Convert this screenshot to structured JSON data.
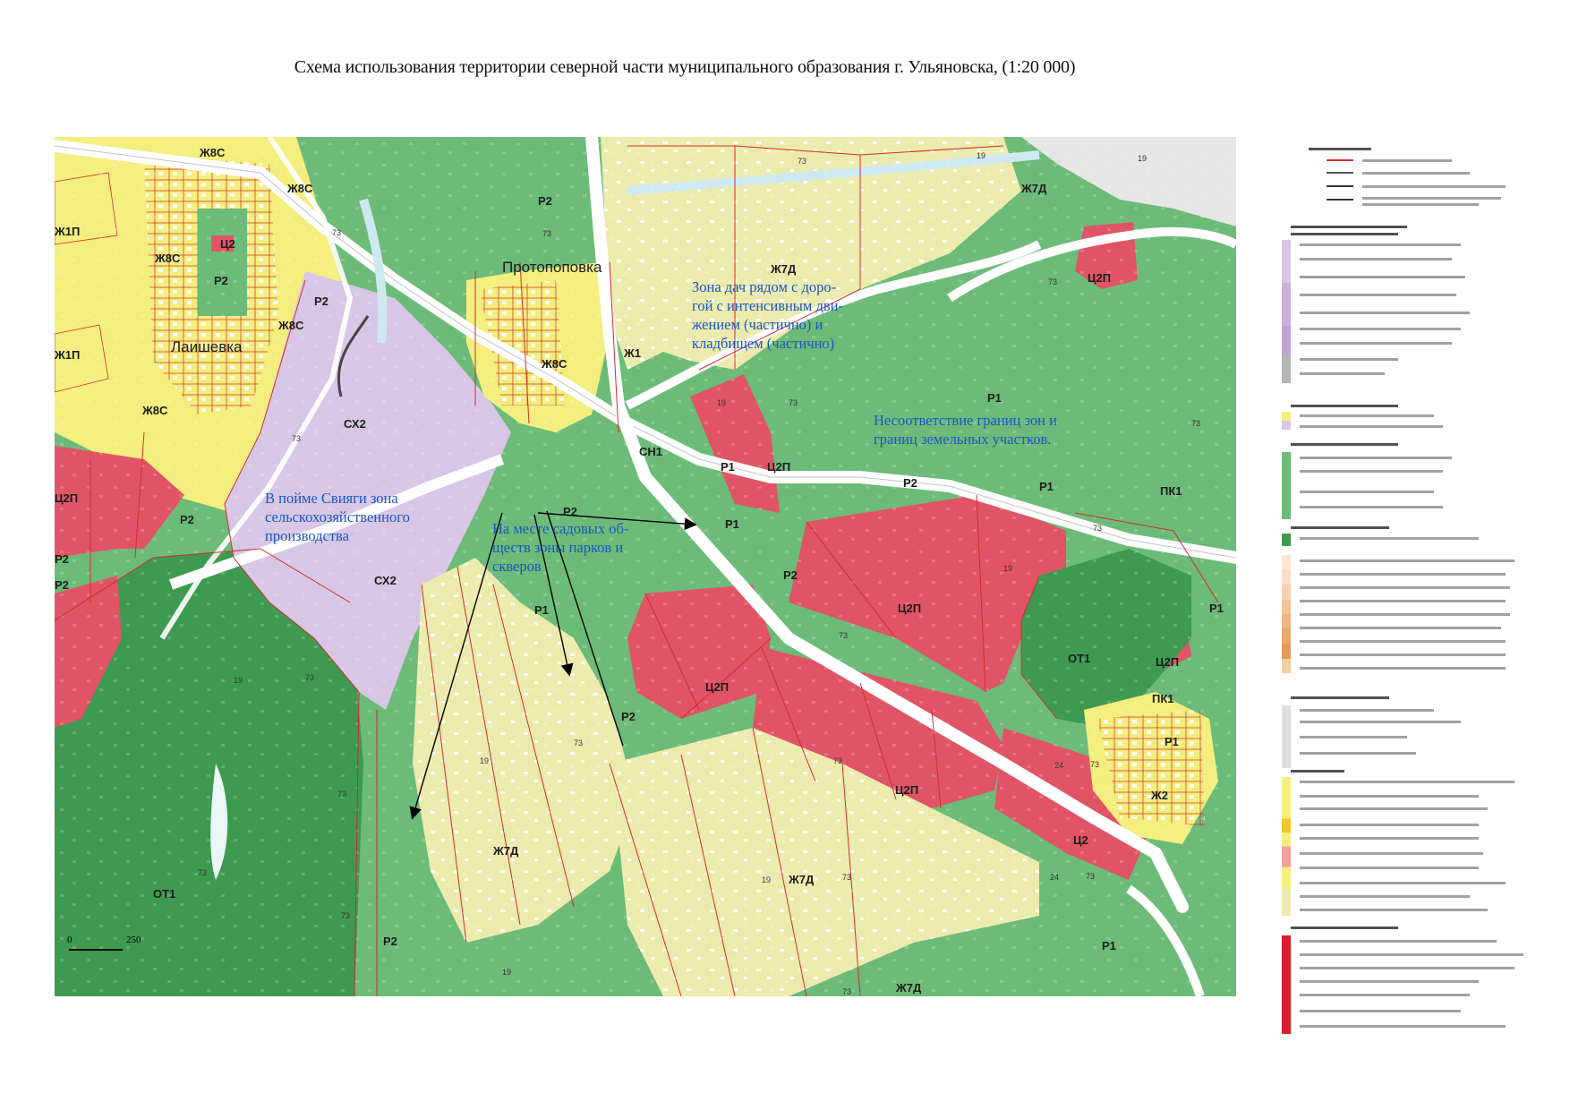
{
  "title": "Схема использования территории северной части муниципального образования г. Ульяновска, (1:20 000)",
  "places": {
    "protopopovka": "Протопоповка",
    "laishevka": "Лаишевка"
  },
  "zone_labels": {
    "zh8s_1": "Ж8С",
    "zh8s_2": "Ж8С",
    "zh8s_3": "Ж8С",
    "zh8s_4": "Ж8С",
    "zh8s_5": "Ж8С",
    "zh8s_6": "Ж8С",
    "zh1p_1": "Ж1П",
    "zh1p_2": "Ж1П",
    "c2_1": "Ц2",
    "c2_2": "Ц2",
    "p2_1": "Р2",
    "p2_2": "Р2",
    "p2_3": "Р2",
    "p2_4": "Р2",
    "p2_5": "Р2",
    "p2_6": "Р2",
    "p2_7": "Р2",
    "p2_8": "Р2",
    "p2_9": "Р2",
    "p2_10": "Р2",
    "p2_11": "Р2",
    "c2p_1": "Ц2П",
    "c2p_2": "Ц2П",
    "c2p_3": "Ц2П",
    "c2p_4": "Ц2П",
    "c2p_5": "Ц2П",
    "c2p_6": "Ц2П",
    "c2p_7": "Ц2П",
    "sx2_1": "СХ2",
    "sx2_2": "СХ2",
    "zh7d_1": "Ж7Д",
    "zh7d_2": "Ж7Д",
    "zh7d_3": "Ж7Д",
    "zh7d_4": "Ж7Д",
    "zh7d_5": "Ж7Д",
    "zh1": "Ж1",
    "zh2": "Ж2",
    "p1_1": "Р1",
    "p1_2": "Р1",
    "p1_3": "Р1",
    "p1_4": "Р1",
    "p1_5": "Р1",
    "p1_6": "Р1",
    "p1_7": "Р1",
    "p1_8": "Р1",
    "ot1_1": "ОТ1",
    "ot1_2": "ОТ1",
    "pk1_1": "ПК1",
    "pk1_2": "ПК1",
    "sn1": "СН1"
  },
  "cad_numbers": {
    "n73": "73",
    "n19": "19",
    "n24": "24"
  },
  "annotations": {
    "dachas": [
      "Зона дач рядом с доро-",
      "гой с интенсивным дви-",
      "жением (частично) и",
      "кладбищем (частично)"
    ],
    "mismatch": [
      "Несоответствие границ зон и",
      "границ земельных участков."
    ],
    "svijaga": [
      "В пойме Свияги зона",
      "сельскохозяйственного",
      "производства"
    ],
    "gardens": [
      "На месте садовых об-",
      "ществ зоны парков и",
      "скверов"
    ]
  },
  "scale": {
    "zero": "0",
    "distance": "250"
  },
  "colors": {
    "residential_yellow": "#f3ee7e",
    "dacha_light_yellow": "#ecebae",
    "recreation_green": "#6dbb78",
    "park_green": "#5aaa6a",
    "forest_dark_green": "#3e9a50",
    "business_red": "#e05466",
    "agricultural_lilac": "#d7c6e5",
    "road_white": "#ffffff",
    "water": "#cfe9f0",
    "boundary_red": "#d22c2c",
    "annotation_blue": "#1a56c4"
  }
}
